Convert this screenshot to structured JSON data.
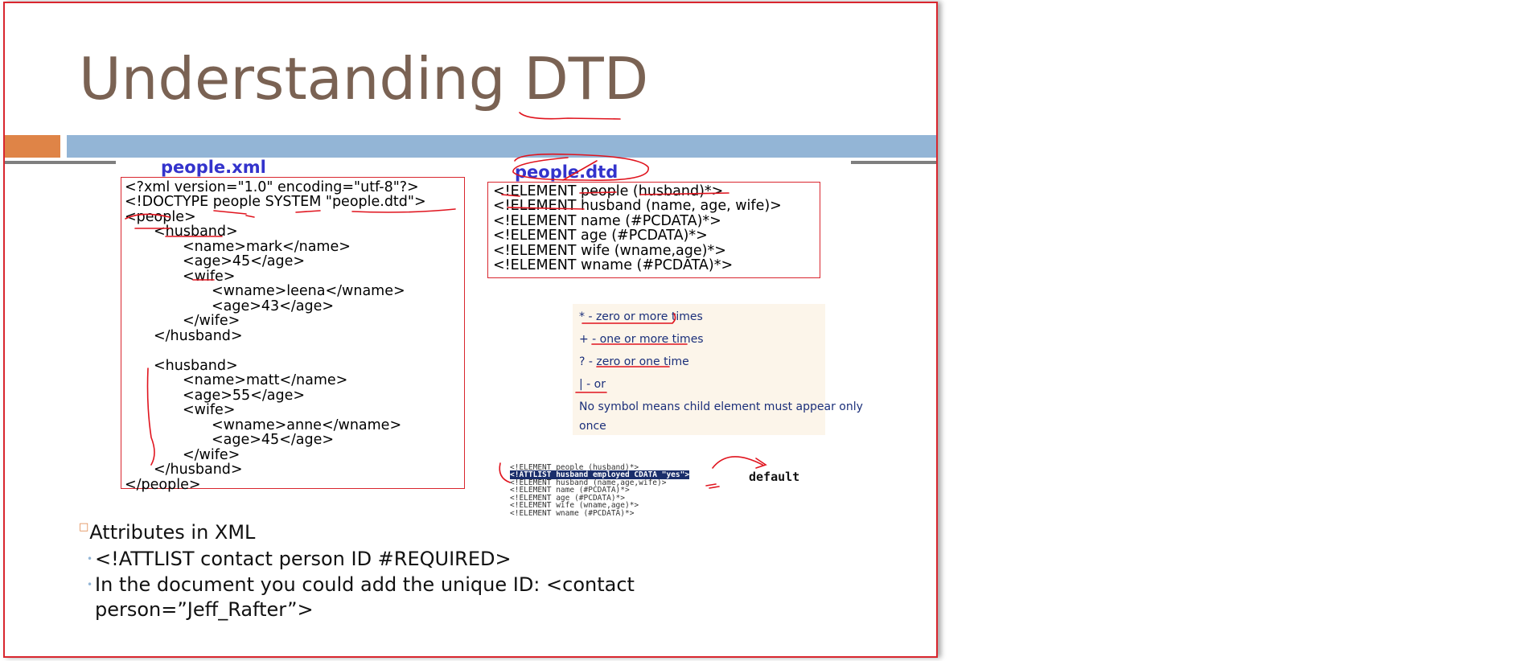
{
  "slide": {
    "title": "Understanding DTD"
  },
  "xml_panel": {
    "heading": "people.xml",
    "lines": [
      "<?xml version=\"1.0\" encoding=\"utf-8\"?>",
      "<!DOCTYPE people SYSTEM \"people.dtd\">",
      "<people>",
      "<husband>",
      "<name>mark</name>",
      "<age>45</age>",
      "<wife>",
      "<wname>leena</wname>",
      "<age>43</age>",
      "</wife>",
      "</husband>",
      "<husband>",
      "<name>matt</name>",
      "<age>55</age>",
      "<wife>",
      "<wname>anne</wname>",
      "<age>45</age>",
      "</wife>",
      "</husband>",
      "</people>"
    ]
  },
  "dtd_panel": {
    "heading": "people.dtd",
    "lines": [
      "<!ELEMENT people (husband)*>",
      "<!ELEMENT husband (name, age, wife)>",
      "<!ELEMENT name (#PCDATA)*>",
      "<!ELEMENT age (#PCDATA)*>",
      "<!ELEMENT wife (wname,age)*>",
      "<!ELEMENT wname (#PCDATA)*>"
    ]
  },
  "symbols_legend": [
    "* - zero or more times",
    "+ - one or more times",
    "? - zero or one time",
    "| - or",
    "No symbol means child element must appear only",
    "once"
  ],
  "attlist_example": {
    "lines": [
      "<!ELEMENT people (husband)*>",
      "<!ATTLIST husband employed CDATA \"yes\">",
      "<!ELEMENT husband (name,age,wife)>",
      "<!ELEMENT name (#PCDATA)*>",
      "<!ELEMENT age (#PCDATA)*>",
      "<!ELEMENT wife (wname,age)*>",
      "<!ELEMENT wname (#PCDATA)*>"
    ],
    "default_label": "default"
  },
  "bullets": {
    "main": "Attributes in XML",
    "subs": [
      "<!ATTLIST contact person ID #REQUIRED>",
      "In the document you could add the unique ID: <contact person=”Jeff_Rafter”>"
    ]
  },
  "colors": {
    "title": "#7a6253",
    "accent_orange": "#df8447",
    "accent_blue": "#93b5d6",
    "slide_border": "#d9262e",
    "ink_red": "#e0141e"
  }
}
